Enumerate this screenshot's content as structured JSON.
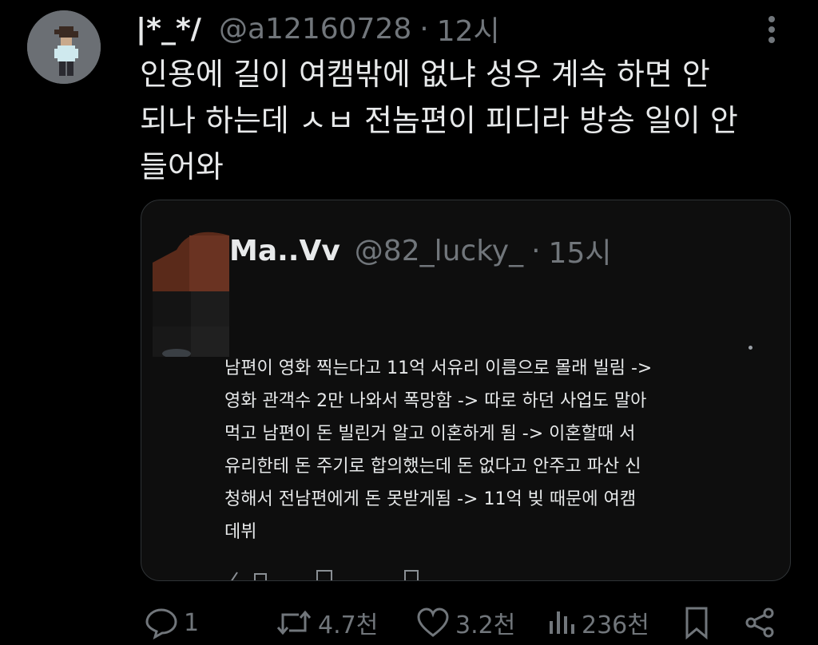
{
  "tweet": {
    "display_name": "|*_*/",
    "handle": "@a12160728",
    "separator": "·",
    "time": "12시",
    "lines": [
      "인용에 길이 여캠밖에 없냐 성우 계속 하면 안",
      "되나 하는데 ㅅㅂ 전놈편이 피디라 방송 일이 안",
      "들어와"
    ]
  },
  "quote": {
    "display_name": "Ma..Vv",
    "handle": "@82_lucky_",
    "separator": "·",
    "time": "15시",
    "lines": [
      "남편이 영화 찍는다고 11억 서유리 이름으로 몰래 빌림 ->",
      "영화 관객수 2만 나와서 폭망함 -> 따로 하던 사업도 말아",
      "먹고 남편이 돈 빌린거 알고 이혼하게 됨 -> 이혼할때 서",
      "유리한테 돈 주기로 합의했는데 돈 없다고 안주고 파산 신",
      "청해서 전남편에게 돈 못받게됨 -> 11억 빚 때문에 여캠",
      "데뷔"
    ]
  },
  "actions": {
    "reply_count": "1",
    "retweet_count": "4.7천",
    "like_count": "3.2천",
    "view_count": "236천"
  },
  "icons": [
    "more-icon",
    "reply-icon",
    "retweet-icon",
    "like-icon",
    "views-icon",
    "bookmark-icon",
    "share-icon"
  ],
  "colors": {
    "background": "#000000",
    "text": "#e7e9ea",
    "muted": "#71767b",
    "border": "#2f3336"
  }
}
